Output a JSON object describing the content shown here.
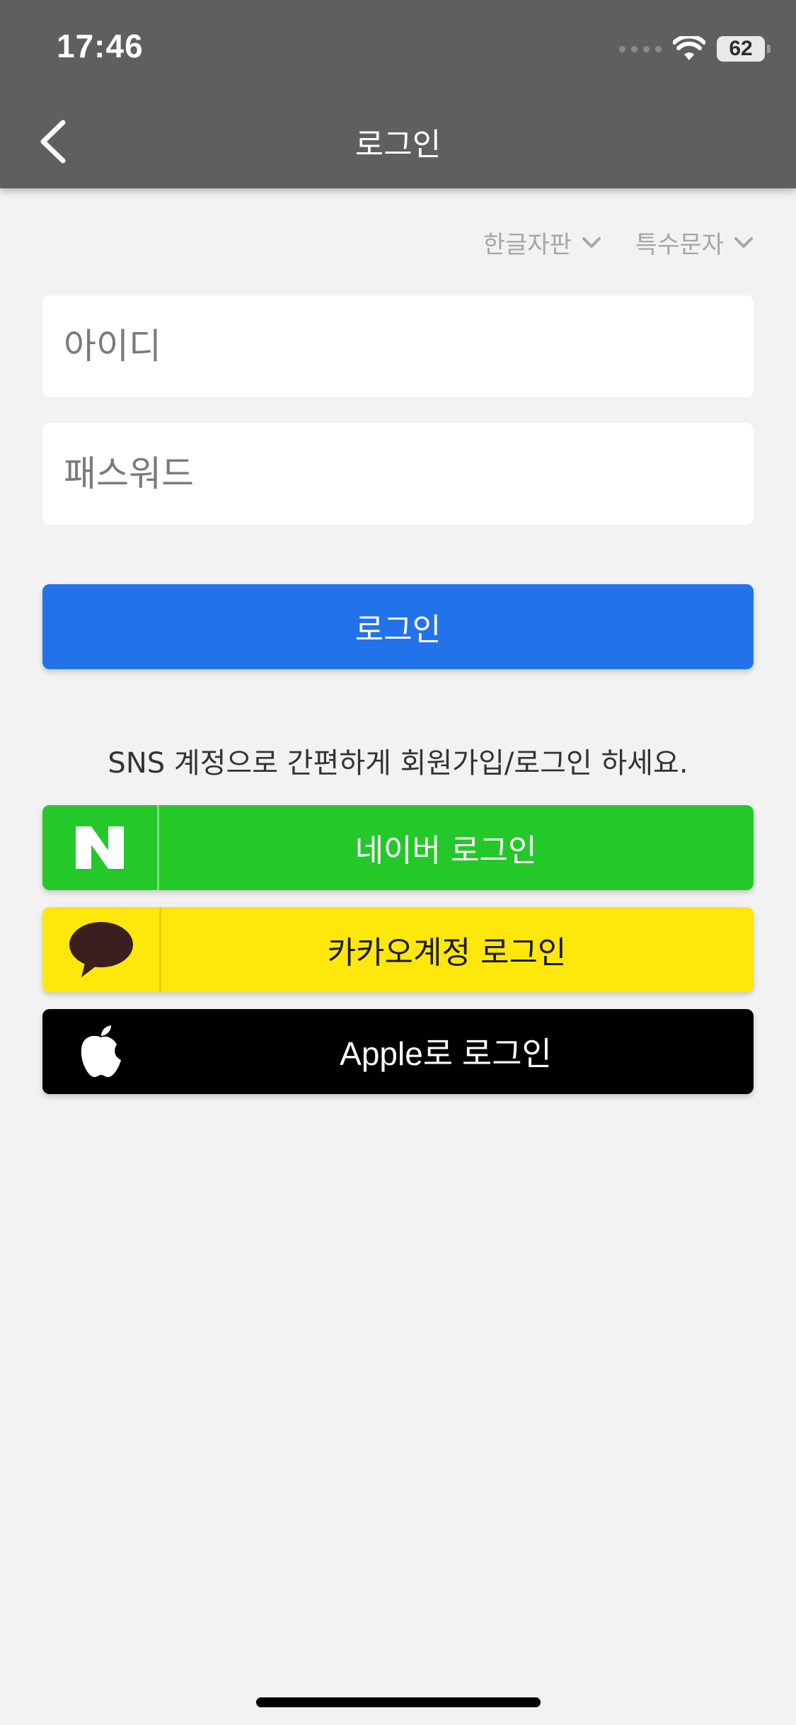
{
  "status_bar": {
    "time": "17:46",
    "battery": "62"
  },
  "nav": {
    "title": "로그인"
  },
  "keyboard_options": [
    {
      "label": "한글자판"
    },
    {
      "label": "특수문자"
    }
  ],
  "form": {
    "id_placeholder": "아이디",
    "password_placeholder": "패스워드",
    "login_label": "로그인"
  },
  "sns": {
    "prompt": "SNS 계정으로 간편하게 회원가입/로그인 하세요.",
    "naver_label": "네이버 로그인",
    "kakao_label": "카카오계정 로그인",
    "apple_label": "Apple로 로그인"
  },
  "colors": {
    "header_bg": "#5f5f5f",
    "page_bg": "#f2f2f2",
    "login_button": "#2273ea",
    "naver_green": "#24c829",
    "kakao_yellow": "#fee70b",
    "apple_black": "#000000"
  },
  "icons": {
    "back": "chevron-left-icon",
    "wifi": "wifi-icon",
    "battery": "battery-icon",
    "naver": "naver-n-icon",
    "kakao": "kakao-bubble-icon",
    "apple": "apple-logo-icon",
    "dropdown": "chevron-down-icon"
  }
}
